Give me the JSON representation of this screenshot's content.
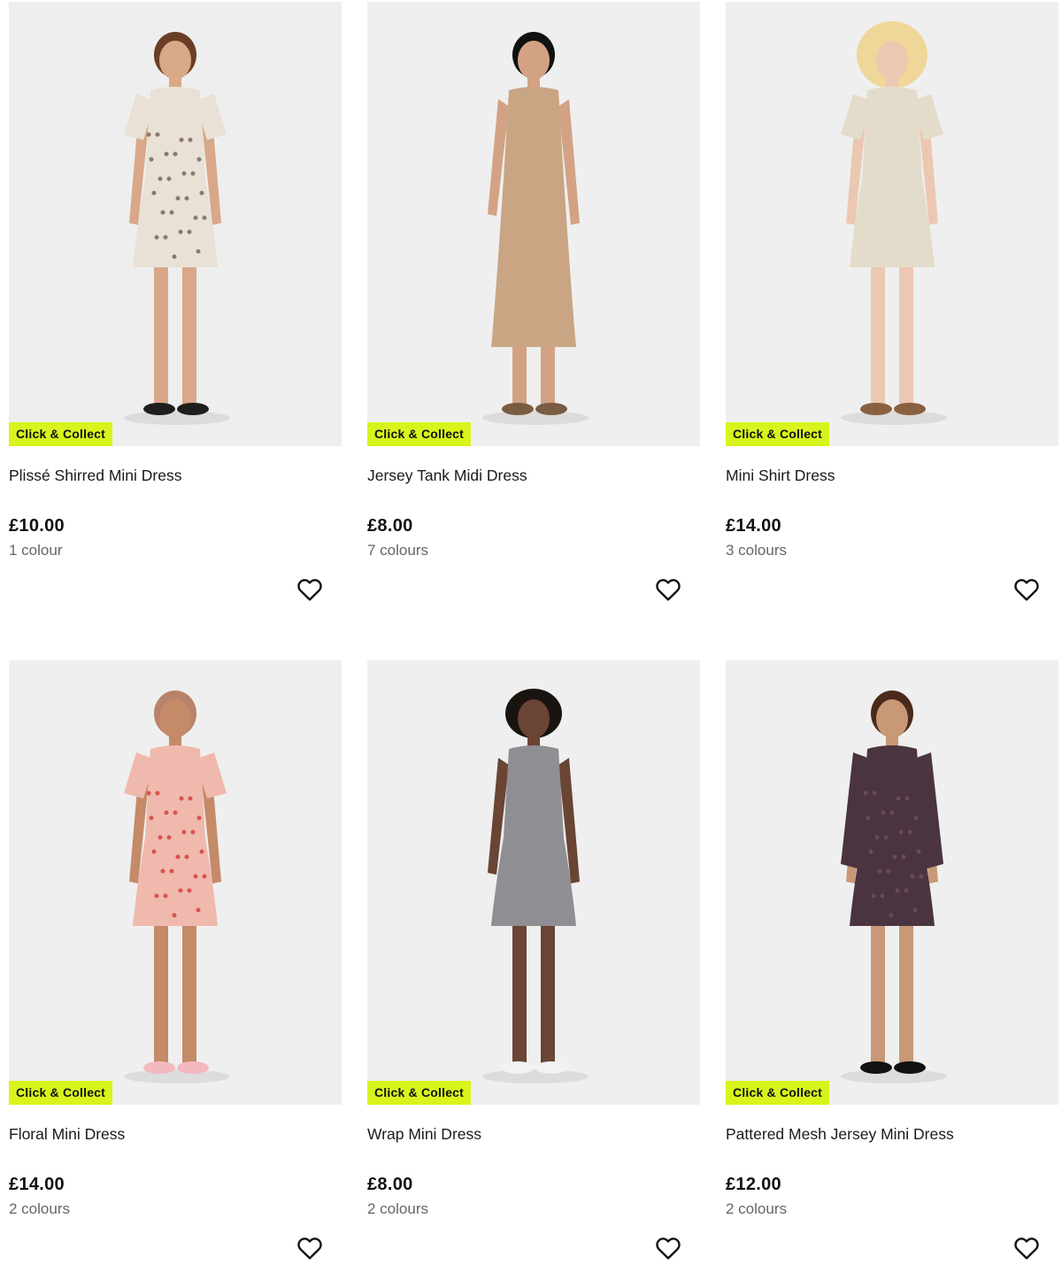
{
  "products": [
    {
      "title": "Plissé Shirred Mini Dress",
      "price": "£10.00",
      "colours": "1 colour",
      "badge": "Click & Collect",
      "bg": "#eeeeee",
      "dress_color": "#e9e1d6",
      "pattern": "#8a7a6a",
      "skin": "#d8a888",
      "hair": "#6b3e26",
      "shoe": "#1e1e1e"
    },
    {
      "title": "Jersey Tank Midi Dress",
      "price": "£8.00",
      "colours": "7 colours",
      "badge": "Click & Collect",
      "bg": "#efefef",
      "dress_color": "#c9a583",
      "pattern": "",
      "skin": "#d3a284",
      "hair": "#111111",
      "shoe": "#7a5c42"
    },
    {
      "title": "Mini Shirt Dress",
      "price": "£14.00",
      "colours": "3 colours",
      "badge": "Click & Collect",
      "bg": "#efefef",
      "dress_color": "#e4dccb",
      "pattern": "",
      "skin": "#ecc8b2",
      "hair": "#efd79a",
      "shoe": "#8a6040"
    },
    {
      "title": "Floral Mini Dress",
      "price": "£14.00",
      "colours": "2 colours",
      "badge": "Click & Collect",
      "bg": "#efefef",
      "dress_color": "#f0b9ad",
      "pattern": "#d9534f",
      "skin": "#c58a68",
      "hair": "#b9826a",
      "shoe": "#f4b8bf"
    },
    {
      "title": "Wrap Mini Dress",
      "price": "£8.00",
      "colours": "2 colours",
      "badge": "Click & Collect",
      "bg": "#efefef",
      "dress_color": "#8e8e93",
      "pattern": "",
      "skin": "#6a4434",
      "hair": "#1a1410",
      "shoe": "#f2f2f2"
    },
    {
      "title": "Pattered Mesh Jersey Mini Dress",
      "price": "£12.00",
      "colours": "2 colours",
      "badge": "Click & Collect",
      "bg": "#efefef",
      "dress_color": "#4a3440",
      "pattern": "#6b4a58",
      "skin": "#c99877",
      "hair": "#4a2a1a",
      "shoe": "#111111"
    }
  ]
}
